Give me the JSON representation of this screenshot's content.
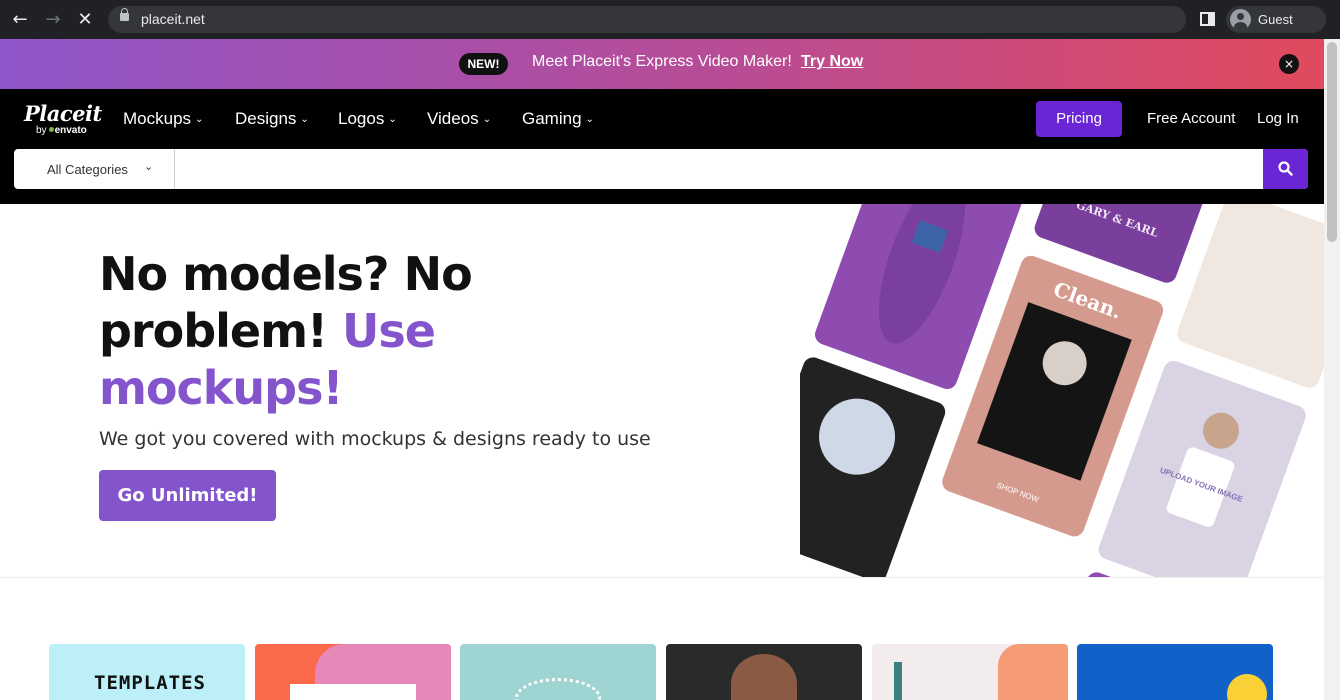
{
  "browser": {
    "url": "placeit.net",
    "profile_name": "Guest"
  },
  "announcement": {
    "badge": "NEW!",
    "text": "Meet Placeit's Express Video Maker!",
    "link": "Try Now",
    "close": "×"
  },
  "header": {
    "logo_word": "Placeit",
    "logo_by": "by",
    "logo_envato": "envato",
    "menu": [
      {
        "label": "Mockups"
      },
      {
        "label": "Designs"
      },
      {
        "label": "Logos"
      },
      {
        "label": "Videos"
      },
      {
        "label": "Gaming"
      }
    ],
    "pricing": "Pricing",
    "free_account": "Free Account",
    "login": "Log In"
  },
  "search": {
    "category": "All Categories",
    "value": "",
    "placeholder": ""
  },
  "hero": {
    "title_1": "No models? No problem! ",
    "title_accent": "Use mockups!",
    "subtitle": "We got you covered with mockups & designs ready to use",
    "cta": "Go Unlimited!",
    "collage_text": {
      "gary_earl": "GARY & EARL",
      "clean": "Clean.",
      "upload": "UPLOAD YOUR IMAGE",
      "shop_now": "SHOP NOW"
    }
  },
  "tiles": {
    "first_label": "TEMPLATES"
  },
  "colors": {
    "brand_purple": "#6a25d4",
    "accent_purple": "#8354cc",
    "banner_start": "#8f55c9",
    "banner_end": "#e14a5d"
  }
}
